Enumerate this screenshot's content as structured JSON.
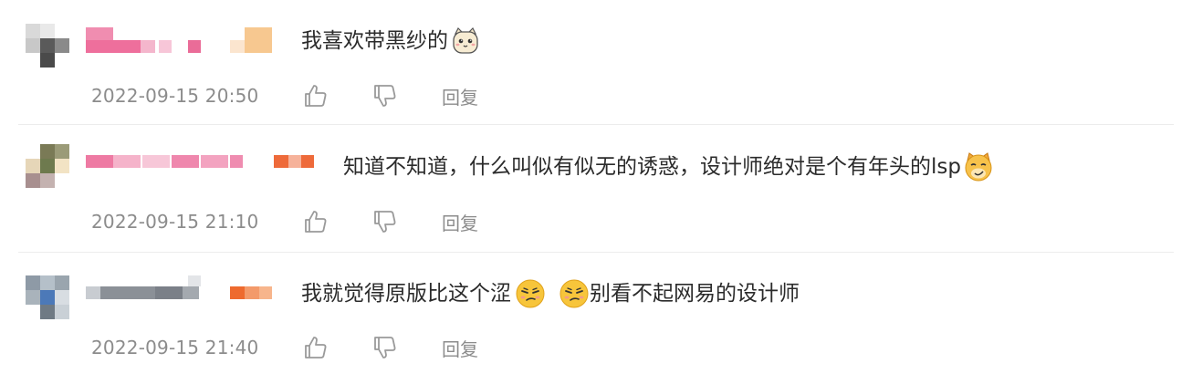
{
  "comments": [
    {
      "text": "我喜欢带黑纱的",
      "emojis": [
        "cat-face-emoji"
      ],
      "timestamp": "2022-09-15 20:50",
      "reply_label": "回复"
    },
    {
      "text": "知道不知道，什么叫似有似无的诱惑，设计师绝对是个有年头的lsp",
      "emojis": [
        "smirking-cat-emoji"
      ],
      "timestamp": "2022-09-15 21:10",
      "reply_label": "回复"
    },
    {
      "text": "我就觉得原版比这个涩",
      "text_after": "别看不起网易的设计师",
      "emojis": [
        "smirking-face-emoji",
        "smirking-face-emoji"
      ],
      "timestamp": "2022-09-15 21:40",
      "reply_label": "回复"
    }
  ],
  "colors": {
    "text": "#2b2b2b",
    "meta": "#8c8c8c",
    "icon": "#9a9a9a",
    "emoji_yellow": "#f7c53b"
  }
}
